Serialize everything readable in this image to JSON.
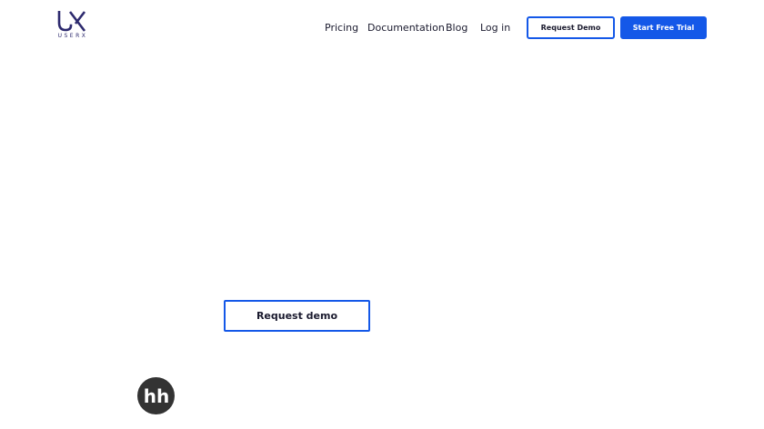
{
  "header": {
    "logo_text": "USERX",
    "nav": [
      {
        "label": "Pricing"
      },
      {
        "label": "Documentation"
      },
      {
        "label": "Blog"
      },
      {
        "label": "Log in"
      }
    ],
    "request_demo_label": "Request Demo",
    "start_trial_label": "Start Free Trial"
  },
  "main": {
    "request_demo_label": "Request demo"
  },
  "client_logo": {
    "icon": "hh-logo",
    "text": "hh"
  },
  "colors": {
    "accent": "#1458e8",
    "logo": "#2d2a6e",
    "client_logo_bg": "#333333"
  }
}
